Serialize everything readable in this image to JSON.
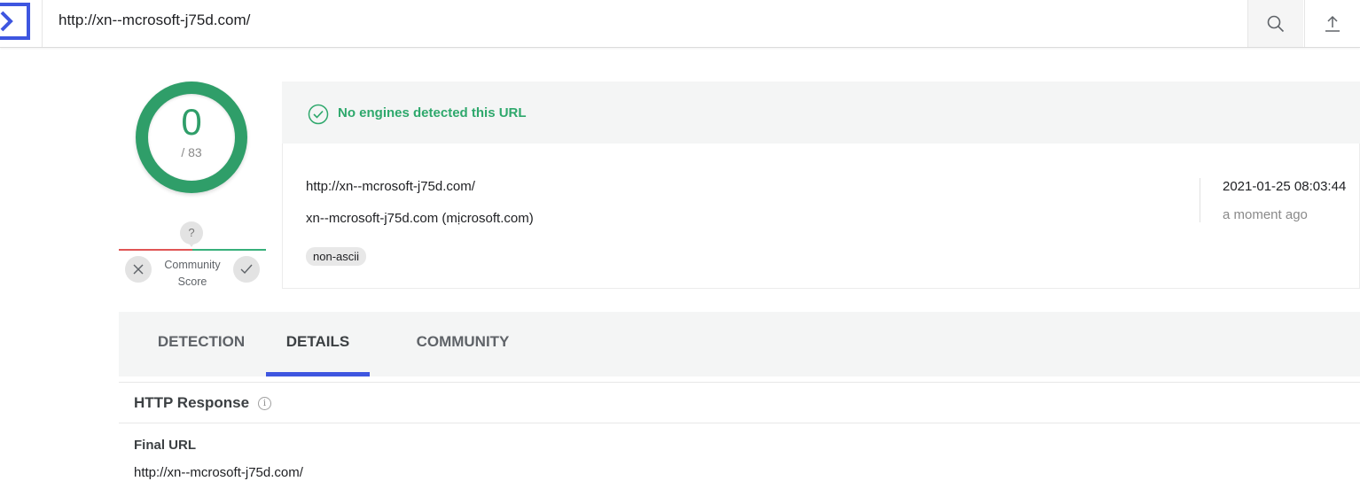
{
  "search": {
    "value": "http://xn--mcrosoft-j75d.com/"
  },
  "score": {
    "detections": "0",
    "total": "/ 83",
    "ring_color": "#2f9e69"
  },
  "community": {
    "bubble": "?",
    "label_line1": "Community",
    "label_line2": "Score"
  },
  "detection": {
    "message": "No engines detected this URL",
    "color": "#2ea86c"
  },
  "info": {
    "url": "http://xn--mcrosoft-j75d.com/",
    "host": "xn--mcrosoft-j75d.com (mịcrosoft.com)",
    "tag": "non-ascii",
    "date": "2021-01-25 08:03:44",
    "ago": "a moment ago"
  },
  "tabs": [
    {
      "label": "DETECTION",
      "active": false
    },
    {
      "label": "DETAILS",
      "active": true
    },
    {
      "label": "COMMUNITY",
      "active": false
    }
  ],
  "details": {
    "section_title": "HTTP Response",
    "final_url_label": "Final URL",
    "final_url_value": "http://xn--mcrosoft-j75d.com/"
  },
  "icons": {
    "logo": "virustotal-logo-icon",
    "search": "search-icon",
    "upload": "upload-icon",
    "check_circle": "check-circle-icon",
    "close": "close-icon",
    "check": "check-icon",
    "info": "info-icon"
  },
  "colors": {
    "accent": "#3e56e0",
    "danger": "#e05555",
    "success": "#37b07a"
  }
}
